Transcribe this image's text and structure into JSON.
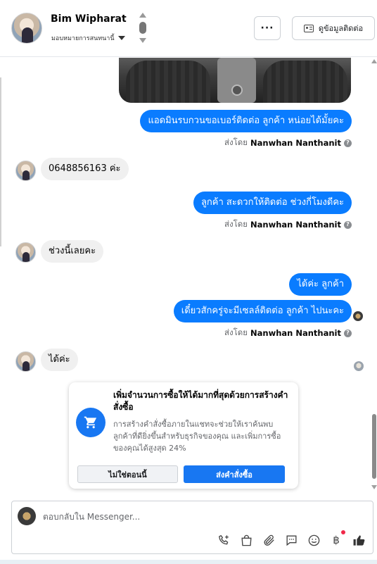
{
  "header": {
    "contact_name": "Bim Wipharat",
    "assign_label": "มอบหมายการสนทนานี้",
    "more_label": "···",
    "contact_info_label": "ดูข้อมูลติดต่อ"
  },
  "messages": [
    {
      "id": "m1",
      "direction": "out",
      "text": "แอดมินรบกวนขอเบอร์ติดต่อ ลูกค้า หน่อยได้มั้ยคะ"
    },
    {
      "id": "m2",
      "direction": "in",
      "text": "0648856163 ค่ะ"
    },
    {
      "id": "m3",
      "direction": "out",
      "text": "ลูกค้า สะดวกให้ติดต่อ ช่วงกี่โมงดีคะ"
    },
    {
      "id": "m4",
      "direction": "in",
      "text": "ช่วงนี้เลยคะ"
    },
    {
      "id": "m5",
      "direction": "out",
      "text": "ได้ค่ะ ลูกค้า"
    },
    {
      "id": "m6",
      "direction": "out",
      "text": "เดี๋ยวสักครู่จะมีเซลล์ติดต่อ ลูกค้า ไปนะคะ"
    },
    {
      "id": "m7",
      "direction": "in",
      "text": "ได้ค่ะ"
    }
  ],
  "sent_by": {
    "prefix": "ส่งโดย",
    "name": "Nanwhan Nanthanit",
    "help_label": "?"
  },
  "promo": {
    "title": "เพิ่มจำนวนการซื้อให้ได้มากที่สุดด้วยการสร้างคำสั่งซื้อ",
    "description": "การสร้างคำสั่งซื้อภายในแชทจะช่วยให้เราค้นพบลูกค้าที่ดียิ่งขึ้นสำหรับธุรกิจของคุณ และเพิ่มการซื้อของคุณได้สูงสุด 24%",
    "not_now_label": "ไม่ใช่ตอนนี้",
    "send_order_label": "ส่งคำสั่งซื้อ"
  },
  "composer": {
    "placeholder": "ตอบกลับใน Messenger...",
    "baht_symbol": "฿"
  },
  "colors": {
    "outgoing_bubble": "#0a7cff",
    "incoming_bubble": "#f0f0f0",
    "accent": "#1877f2"
  }
}
